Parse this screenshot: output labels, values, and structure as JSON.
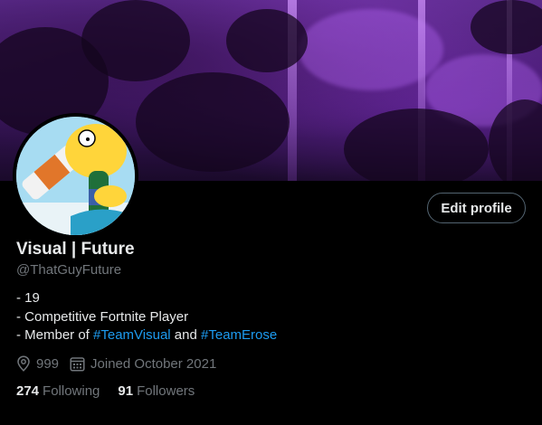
{
  "profile": {
    "display_name": "Visual | Future",
    "handle": "@ThatGuyFuture",
    "edit_button_label": "Edit profile",
    "bio": {
      "line1": "- 19",
      "line2": "- Competitive Fortnite Player",
      "line3_prefix": "- Member of ",
      "tag1": "#TeamVisual",
      "connector": " and ",
      "tag2": "#TeamErose"
    },
    "location": "999",
    "joined": "Joined October 2021",
    "following_count": "274",
    "following_label": "Following",
    "followers_count": "91",
    "followers_label": "Followers"
  },
  "icons": {
    "location": "location-pin-icon",
    "joined": "calendar-icon"
  },
  "colors": {
    "background": "#000000",
    "accent": "#1d9bf0",
    "secondary_text": "#71767b",
    "primary_text": "#e7e9ea",
    "button_border": "#536471"
  }
}
